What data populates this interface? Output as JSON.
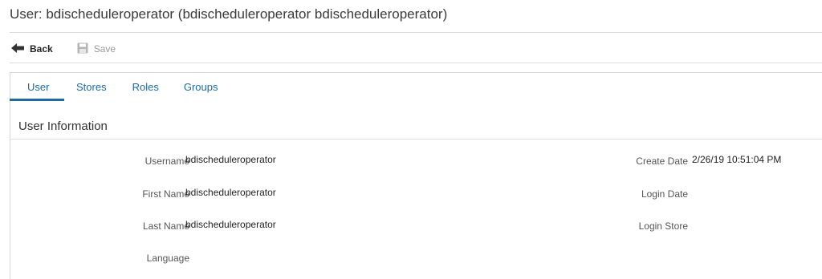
{
  "page": {
    "title": "User: bdischeduleroperator (bdischeduleroperator bdischeduleroperator)"
  },
  "toolbar": {
    "back_label": "Back",
    "back_icon": "arrow-left-icon",
    "save_label": "Save",
    "save_icon": "floppy-disk-icon"
  },
  "tabs": [
    {
      "label": "User",
      "active": true
    },
    {
      "label": "Stores",
      "active": false
    },
    {
      "label": "Roles",
      "active": false
    },
    {
      "label": "Groups",
      "active": false
    }
  ],
  "section": {
    "title": "User Information"
  },
  "fields_left": [
    {
      "label": "Username",
      "value": "bdischeduleroperator"
    },
    {
      "label": "First Name",
      "value": "bdischeduleroperator"
    },
    {
      "label": "Last Name",
      "value": "bdischeduleroperator"
    },
    {
      "label": "Language",
      "value": ""
    }
  ],
  "fields_right": [
    {
      "label": "Create Date",
      "value": "2/26/19 10:51:04 PM"
    },
    {
      "label": "Login Date",
      "value": ""
    },
    {
      "label": "Login Store",
      "value": ""
    }
  ],
  "colors": {
    "accent": "#1f6aa5",
    "divider": "#dcdcdc",
    "disabled": "#9a9a9a"
  }
}
